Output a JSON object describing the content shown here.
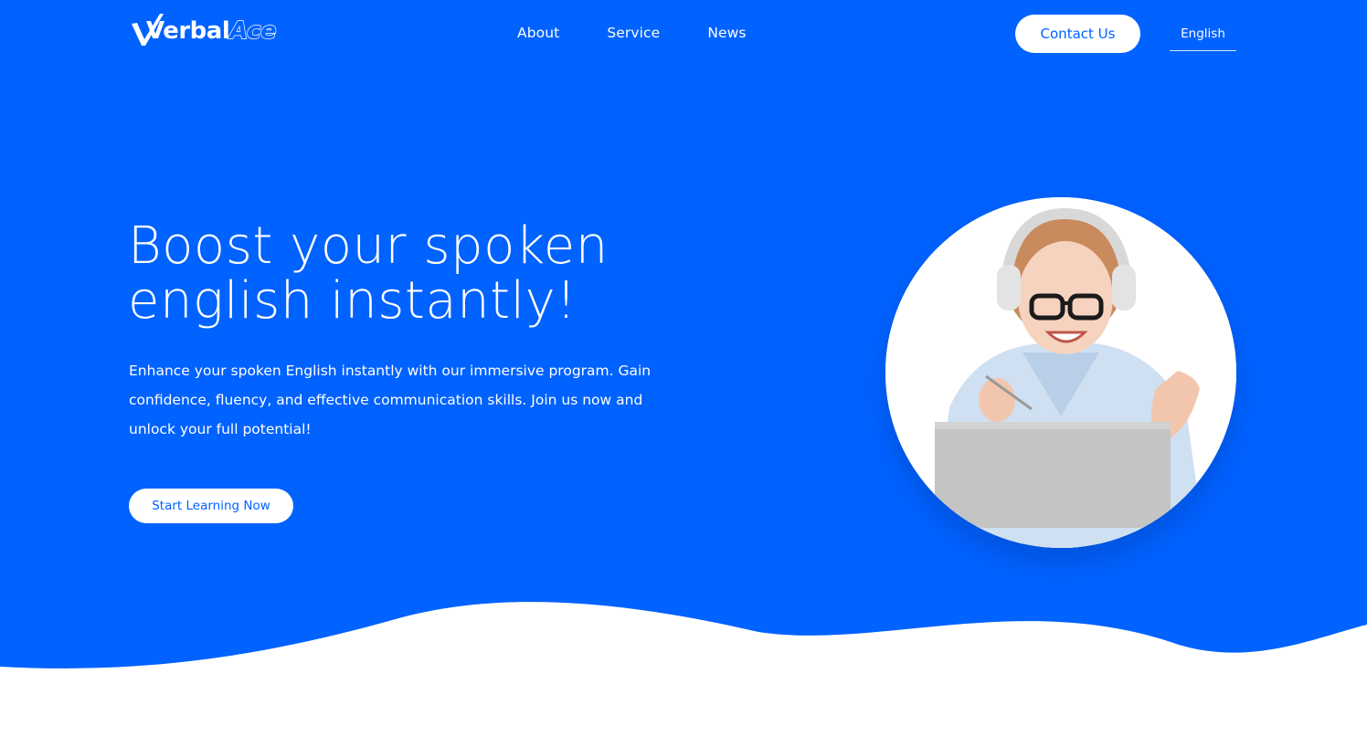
{
  "brand": {
    "logo_part1": "Verbal",
    "logo_part2": "Ace"
  },
  "nav": {
    "items": [
      {
        "label": "About"
      },
      {
        "label": "Service"
      },
      {
        "label": "News"
      }
    ]
  },
  "header": {
    "contact_label": "Contact Us",
    "language_label": "English"
  },
  "hero": {
    "headline_line1": "Boost your spoken",
    "headline_line2": "english instantly!",
    "description": "Enhance your spoken English instantly with our immersive program. Gain confidence, fluency, and effective communication skills. Join us now and unlock your full potential!",
    "cta_label": "Start Learning Now"
  },
  "colors": {
    "brand_blue": "#0062FF",
    "white": "#FFFFFF"
  }
}
